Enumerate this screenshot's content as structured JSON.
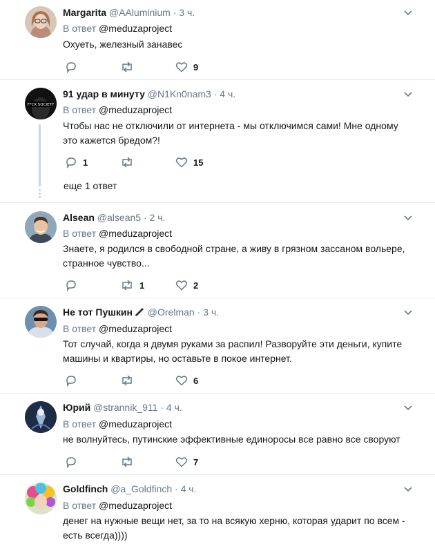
{
  "reply_prefix": "В ответ",
  "reply_target": "@meduzaproject",
  "colors": {
    "text": "#14171a",
    "muted": "#657786",
    "border": "#e6ecf0",
    "thread": "#ccd6dd"
  },
  "tweets": [
    {
      "name": "Margarita",
      "handle": "@AAluminium",
      "time": "3 ч.",
      "text": [
        "Охуеть, железный занавес"
      ],
      "replies": "",
      "retweets": "",
      "likes": "9"
    },
    {
      "name": "91 удар в минуту",
      "handle": "@N1Kn0nam3",
      "time": "4 ч.",
      "text": [
        "Чтобы нас не отключили от интернета - мы отключимся сами! Мне одному",
        "это кажется бредом?!"
      ],
      "replies": "1",
      "retweets": "",
      "likes": "15",
      "more_replies": "еще 1 ответ",
      "avatar_text": "F*CK SOCIETY"
    },
    {
      "name": "Alsean",
      "handle": "@alsean5",
      "time": "2 ч.",
      "text": [
        "Знаете, я родился в свободной стране, а живу в грязном зассаном вольере,",
        "странное чувство..."
      ],
      "replies": "",
      "retweets": "1",
      "likes": "2"
    },
    {
      "name": "Не тот Пушкин",
      "handle": "@Orelman",
      "time": "3 ч.",
      "text": [
        "Тот случай, когда я двумя руками за распил! Разворуйте эти деньги, купите",
        "машины и квартиры, но оставьте в покое интернет."
      ],
      "replies": "",
      "retweets": "",
      "likes": "6"
    },
    {
      "name": "Юрий",
      "handle": "@strannik_911",
      "time": "4 ч.",
      "text": [
        "не волнуйтесь, путинские эффективные единоросы все равно все своруют"
      ],
      "replies": "",
      "retweets": "",
      "likes": "7"
    },
    {
      "name": "Goldfinch",
      "handle": "@a_Goldfinch",
      "time": "4 ч.",
      "text": [
        "денег на нужные вещи нет, за то на всякую херню, которая ударит по всем -",
        "есть всегда))))"
      ],
      "replies": "",
      "retweets": "",
      "likes": ""
    }
  ],
  "icons": {
    "reply": "reply-icon",
    "retweet": "retweet-icon",
    "like": "heart-icon",
    "menu": "chevron-down-icon",
    "pen": "pen-icon"
  }
}
